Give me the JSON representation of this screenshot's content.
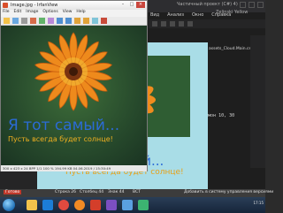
{
  "ide": {
    "title": "Частичный проект (C#) 4)",
    "account": "Zelinski Yellow",
    "menu": [
      "Вид",
      "Анализ",
      "Окно",
      "Справка"
    ],
    "tab_label": "assets_Cloud.Main.cs",
    "code_text": "Гармон 10, 30",
    "status_items": [
      "Готово",
      "Строка 26",
      "Столбец 44",
      "Знак 44",
      "ВСТ",
      "Добавить в систему управления версиями"
    ],
    "panel_lines": [
      "Список заданий",
      "Все решения"
    ]
  },
  "viewer": {
    "title": "Image.jpg - IrfanView",
    "menu": [
      "File",
      "Edit",
      "Image",
      "Options",
      "View",
      "Help"
    ],
    "caption_main": "Я тот самый...",
    "caption_sub": "Пусть всегда будет солнце!",
    "status": "300 x 423 x 24 BPP  1/1  100 %  194.99 KB  04.06.2019 / 15:30:49"
  },
  "preview": {
    "caption_main": "Я тот самый...",
    "caption_sub": "Пусть всегда будет солнце!"
  },
  "taskbar": {
    "tray_time": "17:15",
    "apps": [
      {
        "icon": "folder-icon",
        "color": "#f1c24b"
      },
      {
        "icon": "media-player-icon",
        "color": "#1c7dd6"
      },
      {
        "icon": "chrome-icon",
        "color": "#e04a3f"
      },
      {
        "icon": "firefox-icon",
        "color": "#f08a24"
      },
      {
        "icon": "irfanview-icon",
        "color": "#d43e2a"
      },
      {
        "icon": "visual-studio-icon",
        "color": "#7b4fc2"
      },
      {
        "icon": "explorer-icon",
        "color": "#5aa0e0"
      },
      {
        "icon": "paint-icon",
        "color": "#3cb371"
      }
    ]
  },
  "colors": {
    "caption_blue": "#2b6bd6",
    "caption_orange": "#f0b020",
    "ide_accent": "#c0392b"
  }
}
